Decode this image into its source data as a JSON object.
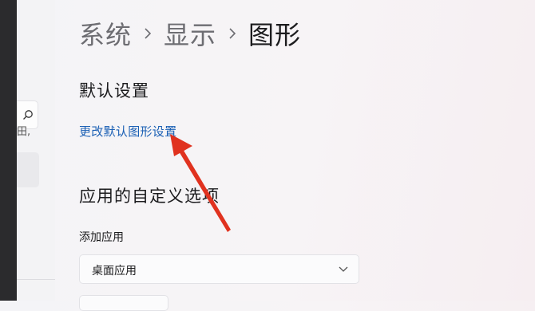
{
  "breadcrumb": {
    "items": [
      "系统",
      "显示"
    ],
    "current": "图形"
  },
  "default_section": {
    "title": "默认设置",
    "link": "更改默认图形设置"
  },
  "app_section": {
    "title": "应用的自定义选项",
    "add_label": "添加应用",
    "dropdown_value": "桌面应用"
  },
  "left_panel": {
    "cut_text": "田,"
  },
  "colors": {
    "link": "#1a5fb4",
    "annotation_arrow": "#e0321f"
  },
  "icons": [
    "search-icon",
    "chevron-right-icon",
    "chevron-down-icon",
    "annotation-arrow"
  ]
}
